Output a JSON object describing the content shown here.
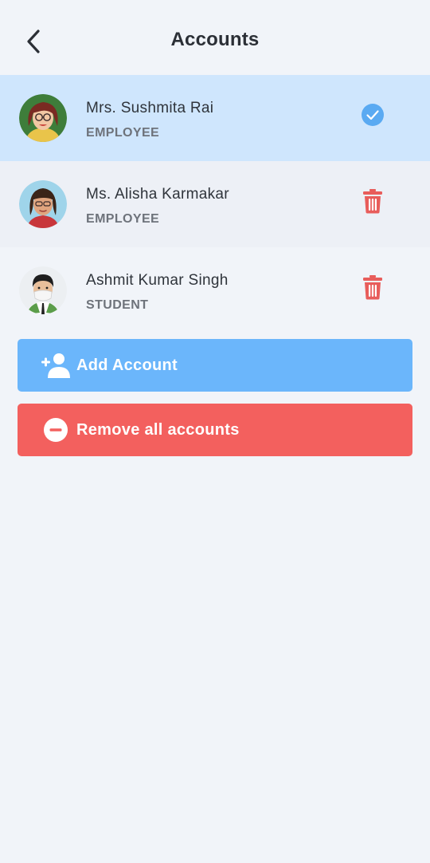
{
  "header": {
    "title": "Accounts",
    "back_icon": "chevron-left-icon"
  },
  "accounts": [
    {
      "name": "Mrs. Sushmita Rai",
      "role": "EMPLOYEE",
      "selected": true,
      "action_icon": "check-circle-icon"
    },
    {
      "name": "Ms. Alisha Karmakar",
      "role": "EMPLOYEE",
      "selected": false,
      "action_icon": "trash-icon"
    },
    {
      "name": "Ashmit Kumar Singh",
      "role": "STUDENT",
      "selected": false,
      "action_icon": "trash-icon"
    }
  ],
  "actions": {
    "add_label": "Add Account",
    "add_icon": "add-user-icon",
    "remove_all_label": "Remove all accounts",
    "remove_all_icon": "minus-circle-icon"
  },
  "colors": {
    "background": "#f1f4f9",
    "selected_row": "#cfe6fd",
    "accent_blue": "#6bb6fb",
    "check_blue": "#5aaaf2",
    "danger_red": "#f3605e",
    "trash_red": "#e85d5b"
  }
}
